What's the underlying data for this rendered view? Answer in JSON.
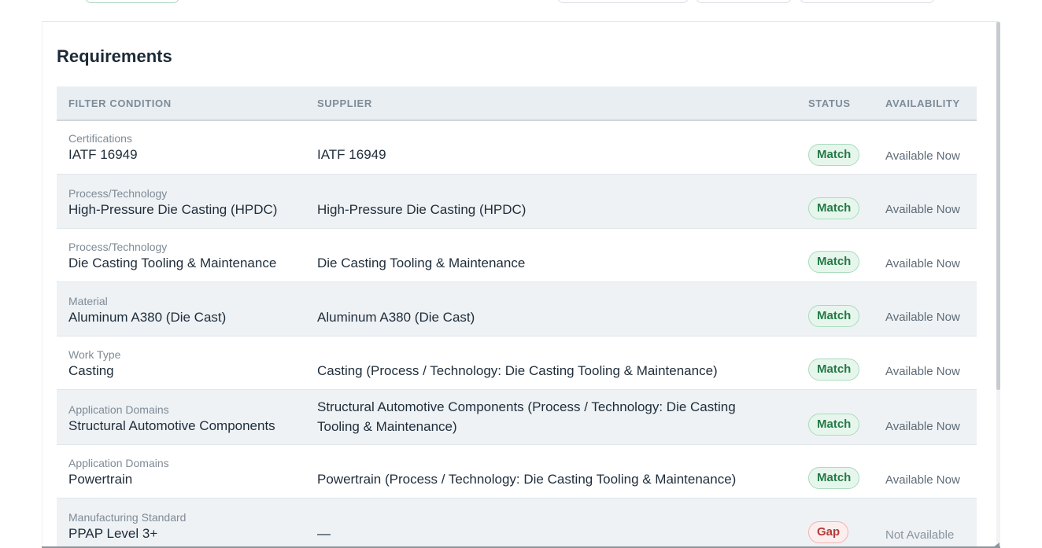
{
  "section_title": "Requirements",
  "columns": {
    "filter_condition": "FILTER CONDITION",
    "supplier": "SUPPLIER",
    "status": "STATUS",
    "availability": "AVAILABILITY"
  },
  "rows": [
    {
      "category": "Certifications",
      "value": "IATF 16949",
      "supplier": "IATF 16949",
      "status": "Match",
      "availability": "Available Now"
    },
    {
      "category": "Process/Technology",
      "value": "High-Pressure Die Casting (HPDC)",
      "supplier": "High-Pressure Die Casting (HPDC)",
      "status": "Match",
      "availability": "Available Now"
    },
    {
      "category": "Process/Technology",
      "value": "Die Casting Tooling & Maintenance",
      "supplier": "Die Casting Tooling & Maintenance",
      "status": "Match",
      "availability": "Available Now"
    },
    {
      "category": "Material",
      "value": "Aluminum A380 (Die Cast)",
      "supplier": "Aluminum A380 (Die Cast)",
      "status": "Match",
      "availability": "Available Now"
    },
    {
      "category": "Work Type",
      "value": "Casting",
      "supplier": "Casting (Process / Technology: Die Casting Tooling & Maintenance)",
      "status": "Match",
      "availability": "Available Now"
    },
    {
      "category": "Application Domains",
      "value": "Structural Automotive Components",
      "supplier": "Structural Automotive Components (Process / Technology: Die Casting Tooling & Maintenance)",
      "status": "Match",
      "availability": "Available Now"
    },
    {
      "category": "Application Domains",
      "value": "Powertrain",
      "supplier": "Powertrain (Process / Technology: Die Casting Tooling & Maintenance)",
      "status": "Match",
      "availability": "Available Now"
    },
    {
      "category": "Manufacturing Standard",
      "value": "PPAP Level 3+",
      "supplier": "—",
      "status": "Gap",
      "availability": "Not Available"
    }
  ],
  "colors": {
    "match_text": "#237a47",
    "match_bg": "#e7f6ec",
    "gap_text": "#b23b3b",
    "gap_bg": "#fdeeee",
    "header_bg": "#e9eef2"
  }
}
